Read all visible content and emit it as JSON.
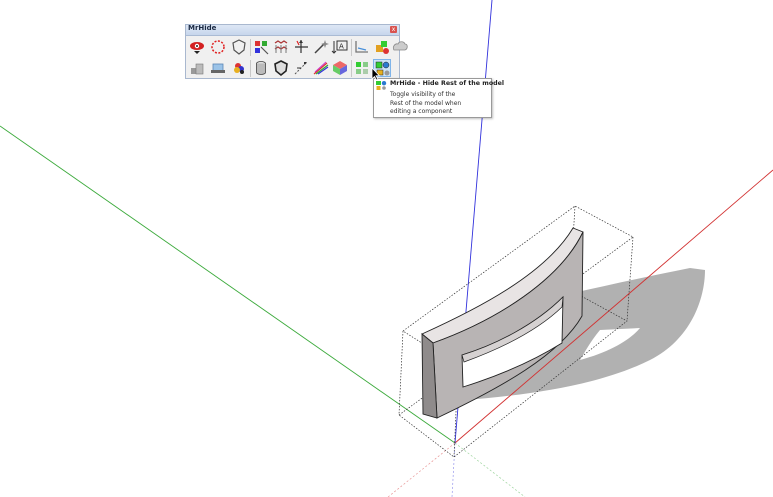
{
  "toolbar": {
    "title": "MrHide",
    "close_glyph": "x",
    "row1_icons": [
      "hide-eye-icon",
      "selection-circle-icon",
      "shield-outline-icon",
      "color-cubes-icon",
      "grid-cubes-icon",
      "axis-arrow-icon",
      "magic-wand-icon",
      "text-label-icon",
      "measure-tool-icon",
      "paint-cubes-icon",
      "cloud-shape-icon"
    ],
    "row2_icons": [
      "stacked-boxes-icon",
      "layer-tray-icon",
      "color-palette-icon",
      "cylinder-icon",
      "shield-filled-icon",
      "section-arrow-icon",
      "rainbow-arc-icon",
      "color-box-icon",
      "green-squares-icon",
      "hide-rest-icon"
    ],
    "active_button": "hide-rest-icon"
  },
  "tooltip": {
    "title": "MrHide - Hide Rest of the model",
    "lines": [
      "Toggle visibility of the",
      "Rest of the model when",
      "editing a component"
    ]
  },
  "colors": {
    "axis_green": "#3caa3c",
    "axis_red": "#d23232",
    "axis_blue": "#3232dc",
    "model_face": "#b8b4b4",
    "model_top": "#e8e4e4",
    "shadow": "#a8a8a8"
  }
}
